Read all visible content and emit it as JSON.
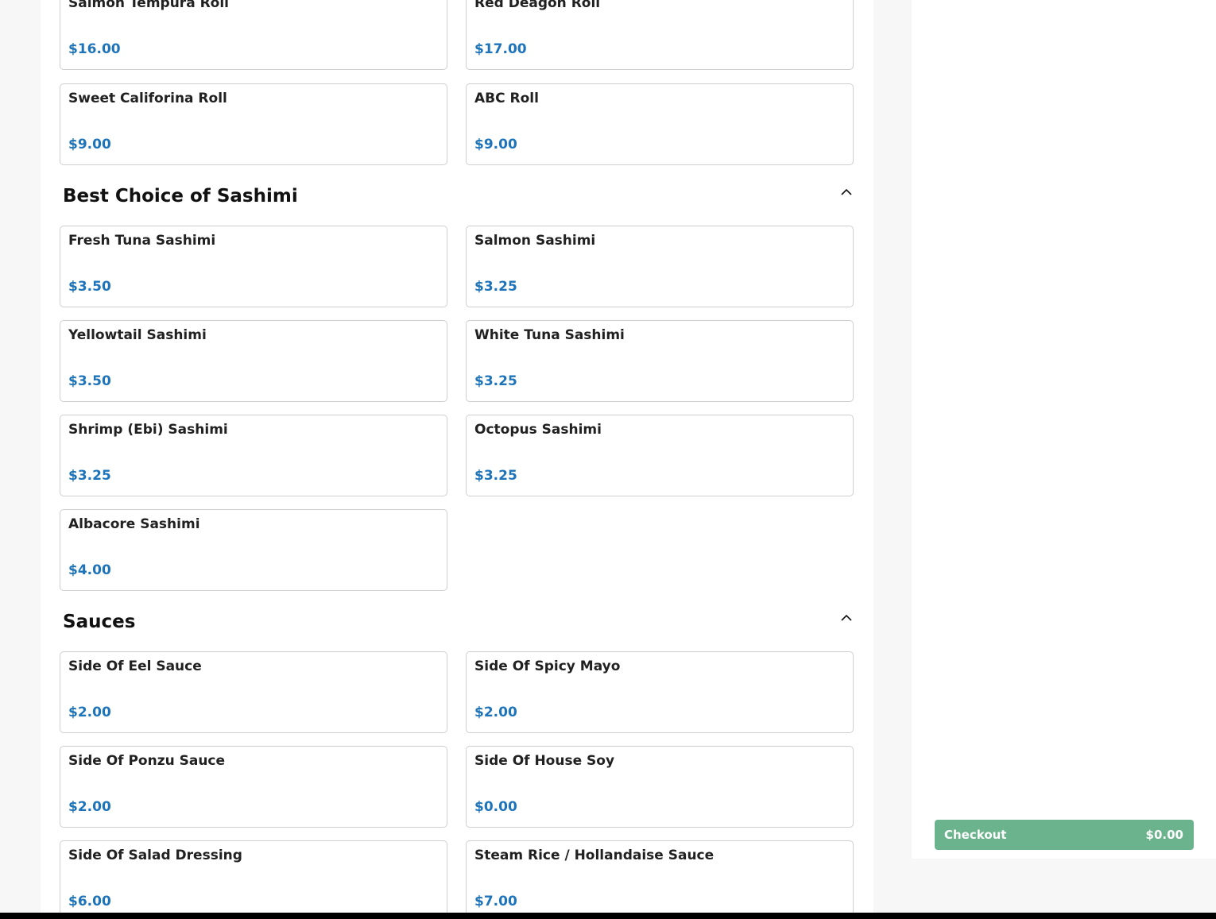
{
  "menu": {
    "rolls_tail": [
      {
        "name": "Salmon Tempura Roll",
        "price": "$16.00"
      },
      {
        "name": "Red Deagon Roll",
        "price": "$17.00"
      },
      {
        "name": "Sweet Califorina Roll",
        "price": "$9.00"
      },
      {
        "name": "ABC Roll",
        "price": "$9.00"
      }
    ],
    "sections": [
      {
        "title": "Best Choice of Sashimi",
        "items": [
          {
            "name": "Fresh Tuna Sashimi",
            "price": "$3.50"
          },
          {
            "name": "Salmon Sashimi",
            "price": "$3.25"
          },
          {
            "name": "Yellowtail Sashimi",
            "price": "$3.50"
          },
          {
            "name": "White Tuna Sashimi",
            "price": "$3.25"
          },
          {
            "name": "Shrimp (Ebi) Sashimi",
            "price": "$3.25"
          },
          {
            "name": "Octopus Sashimi",
            "price": "$3.25"
          },
          {
            "name": "Albacore Sashimi",
            "price": "$4.00"
          }
        ]
      },
      {
        "title": "Sauces",
        "items": [
          {
            "name": "Side Of Eel Sauce",
            "price": "$2.00"
          },
          {
            "name": "Side Of Spicy Mayo",
            "price": "$2.00"
          },
          {
            "name": "Side Of Ponzu Sauce",
            "price": "$2.00"
          },
          {
            "name": "Side Of House Soy",
            "price": "$0.00"
          },
          {
            "name": "Side Of Salad Dressing",
            "price": "$6.00"
          },
          {
            "name": "Steam Rice / Hollandaise Sauce",
            "price": "$7.00"
          }
        ]
      }
    ]
  },
  "cart": {
    "checkout_label": "Checkout",
    "total": "$0.00"
  },
  "icons": {
    "collapse": "chevron-up-icon"
  },
  "colors": {
    "price": "#1e74bb",
    "checkout_bg": "#6ab38c"
  }
}
